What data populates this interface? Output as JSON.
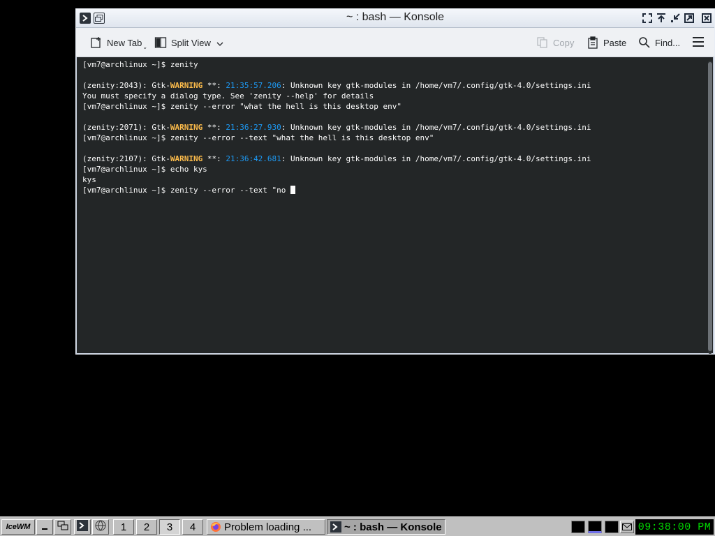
{
  "window": {
    "title": "~ : bash — Konsole",
    "controls": [
      "fullscreen-icon",
      "rollup-icon",
      "restore-icon",
      "maximize-icon",
      "close-icon"
    ]
  },
  "toolbar": {
    "new_tab": "New Tab",
    "split_view": "Split View",
    "copy": "Copy",
    "paste": "Paste",
    "find": "Find...",
    "menu_icon": "hamburger-icon"
  },
  "terminal": {
    "lines": [
      {
        "type": "plain",
        "text": "[vm7@archlinux ~]$ zenity"
      },
      {
        "type": "blank",
        "text": ""
      },
      {
        "type": "warning",
        "prefix": "(zenity:2043): Gtk-",
        "level": "WARNING",
        "sep": " **: ",
        "time": "21:35:57.206",
        "message": ": Unknown key gtk-modules in /home/vm7/.config/gtk-4.0/settings.ini"
      },
      {
        "type": "plain",
        "text": "You must specify a dialog type. See 'zenity --help' for details"
      },
      {
        "type": "plain",
        "text": "[vm7@archlinux ~]$ zenity --error \"what the hell is this desktop env\""
      },
      {
        "type": "blank",
        "text": ""
      },
      {
        "type": "warning",
        "prefix": "(zenity:2071): Gtk-",
        "level": "WARNING",
        "sep": " **: ",
        "time": "21:36:27.930",
        "message": ": Unknown key gtk-modules in /home/vm7/.config/gtk-4.0/settings.ini"
      },
      {
        "type": "plain",
        "text": "[vm7@archlinux ~]$ zenity --error --text \"what the hell is this desktop env\""
      },
      {
        "type": "blank",
        "text": ""
      },
      {
        "type": "warning",
        "prefix": "(zenity:2107): Gtk-",
        "level": "WARNING",
        "sep": " **: ",
        "time": "21:36:42.681",
        "message": ": Unknown key gtk-modules in /home/vm7/.config/gtk-4.0/settings.ini"
      },
      {
        "type": "plain",
        "text": "[vm7@archlinux ~]$ echo kys"
      },
      {
        "type": "plain",
        "text": "kys"
      }
    ],
    "current_input": "[vm7@archlinux ~]$ zenity --error --text \"no "
  },
  "taskbar": {
    "start_label": "IceWM",
    "workspaces": [
      "1",
      "2",
      "3",
      "4"
    ],
    "active_workspace": "3",
    "tasks": [
      {
        "label": "Problem loading ...",
        "icon": "firefox-icon",
        "active": false
      },
      {
        "label": "~ : bash — Konsole",
        "icon": "terminal-icon",
        "active": true
      }
    ],
    "clock": "09:38:00 PM"
  },
  "colors": {
    "terminal_bg": "#232627",
    "warning": "#fdbc4b",
    "timestamp": "#1d99f3",
    "clock_fg": "#00d800"
  }
}
